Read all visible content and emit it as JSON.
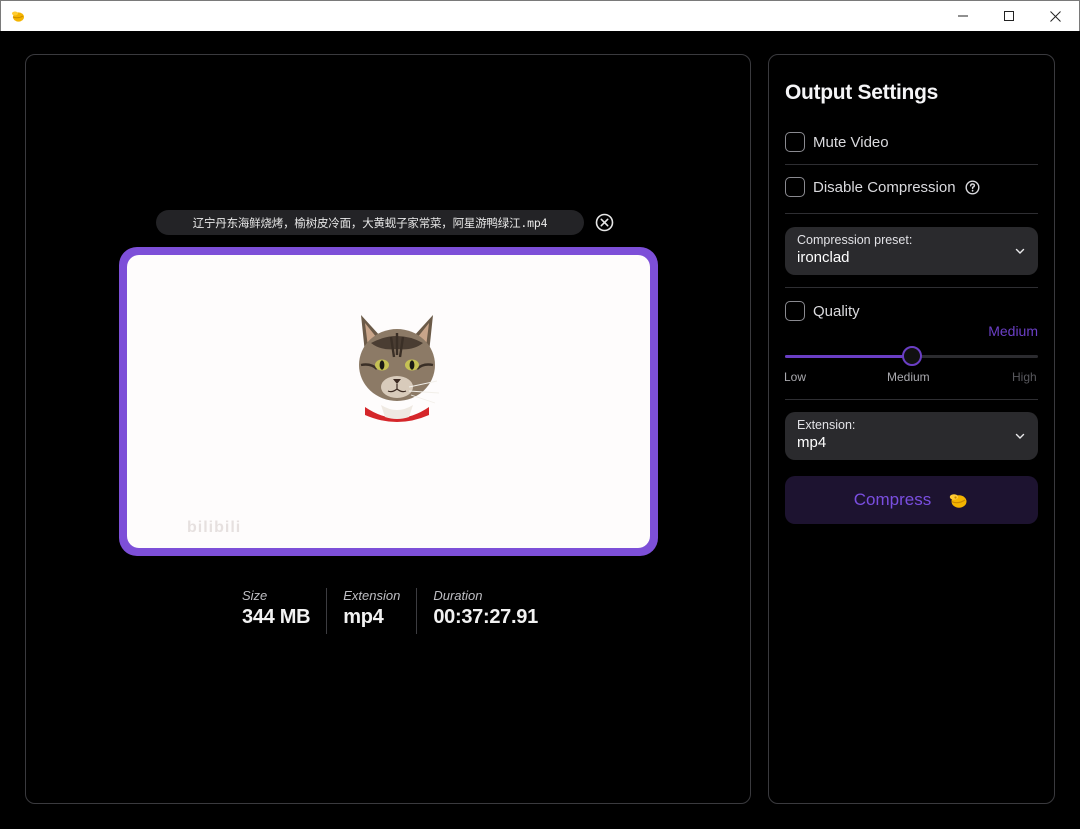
{
  "window": {
    "app_icon": "pinching-hand-icon",
    "controls": [
      "minimize-icon",
      "maximize-icon",
      "close-icon"
    ]
  },
  "preview": {
    "file_name": "辽宁丹东海鲜烧烤，榆树皮冷面，大黄蚬子家常菜，阿星游鸭绿江.mp4",
    "remove_icon": "circle-x-icon",
    "frame_color": "#7d4fd8"
  },
  "stats": [
    {
      "label": "Size",
      "value": "344 MB"
    },
    {
      "label": "Extension",
      "value": "mp4"
    },
    {
      "label": "Duration",
      "value": "00:37:27.91"
    }
  ],
  "settings": {
    "title": "Output Settings",
    "mute_video": {
      "label": "Mute Video",
      "checked": false
    },
    "disable_compression": {
      "label": "Disable Compression",
      "checked": false,
      "help_icon": "question-circle-icon"
    },
    "preset": {
      "label": "Compression preset:",
      "value": "ironclad"
    },
    "quality": {
      "label": "Quality",
      "checked": false,
      "current_level": "Medium",
      "ticks": [
        "Low",
        "Medium",
        "High"
      ],
      "value_fraction": 0.5
    },
    "extension": {
      "label": "Extension:",
      "value": "mp4"
    },
    "compress_button": {
      "label": "Compress",
      "icon": "pinching-hand-icon"
    }
  },
  "colors": {
    "accent": "#7a4ee0",
    "panel_border": "#3a3a3e",
    "select_bg": "#2a2a2d"
  }
}
